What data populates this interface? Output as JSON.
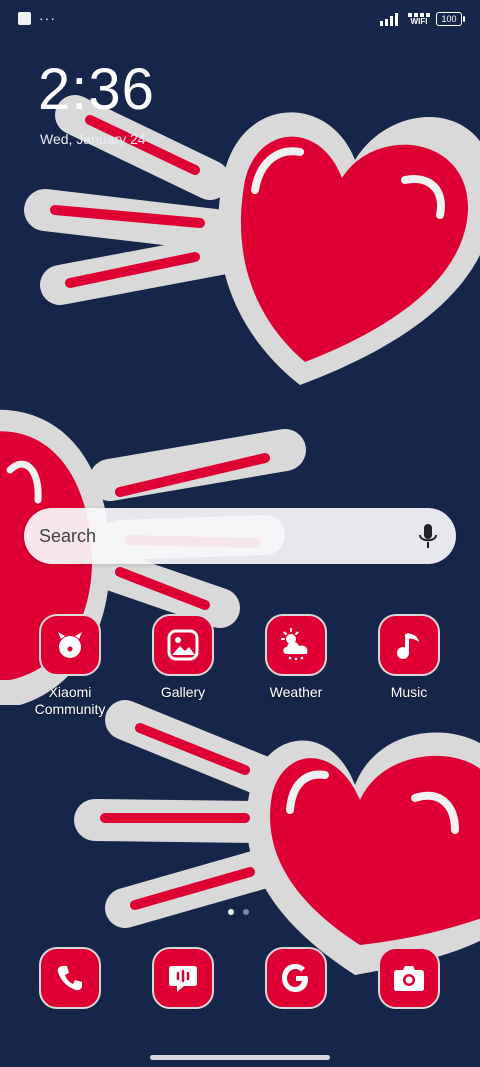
{
  "status_bar": {
    "dots": "···",
    "wifi_label": "WIFI",
    "battery": "100"
  },
  "lock": {
    "time": "2:36",
    "date": "Wed, January 24"
  },
  "search": {
    "placeholder": "Search"
  },
  "apps": [
    {
      "name": "Xiaomi\nCommunity",
      "icon": "xiaomi-community-icon"
    },
    {
      "name": "Gallery",
      "icon": "gallery-icon"
    },
    {
      "name": "Weather",
      "icon": "weather-icon"
    },
    {
      "name": "Music",
      "icon": "music-icon"
    }
  ],
  "dock": [
    {
      "icon": "phone-icon"
    },
    {
      "icon": "messages-icon"
    },
    {
      "icon": "google-icon"
    },
    {
      "icon": "camera-icon"
    }
  ],
  "page_indicator": {
    "pages": 2,
    "current": 1
  },
  "colors": {
    "background": "#16264a",
    "heart_red": "#de0033",
    "outline_gray": "#d9d9d9",
    "icon_red": "#de0033"
  }
}
